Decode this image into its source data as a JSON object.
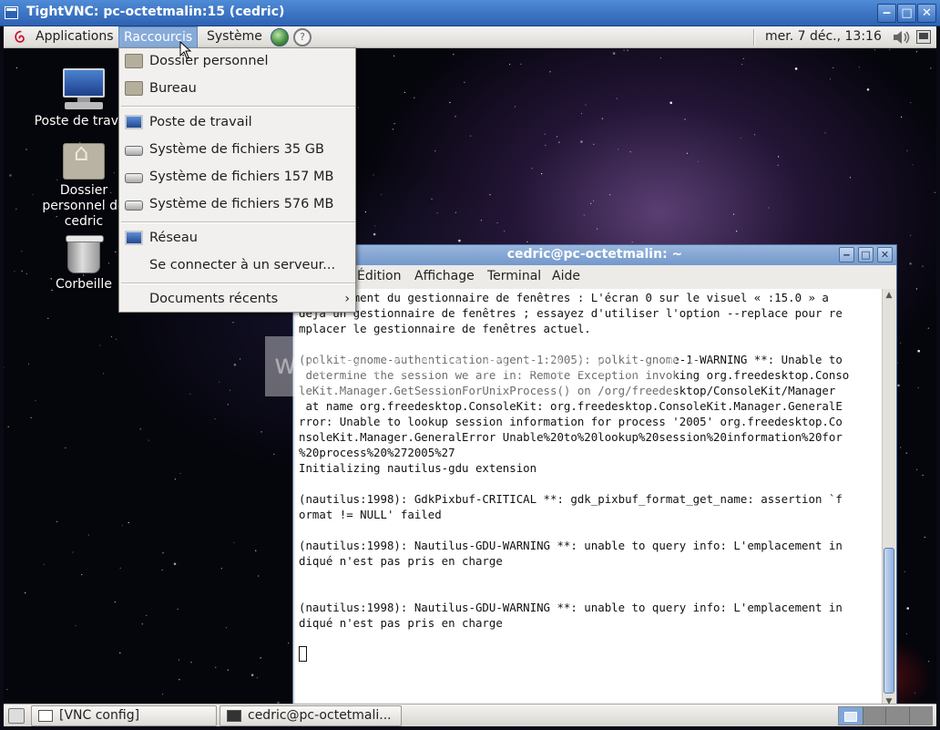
{
  "vnc_window": {
    "title": "TightVNC: pc-octetmalin:15 (cedric)",
    "minimize_symbol": "‒",
    "maximize_symbol": "□",
    "close_symbol": "✕"
  },
  "top_panel": {
    "menus": [
      "Applications",
      "Raccourcis",
      "Système"
    ],
    "clock": "mer.  7 déc., 13:16",
    "launcher_icons": [
      "network-browser-icon",
      "help-icon"
    ],
    "accent_color": "#86abd9"
  },
  "desktop": {
    "icons": [
      {
        "label": "Poste de travail",
        "icon": "computer-icon"
      },
      {
        "label": "Dossier personnel de cedric",
        "icon": "home-folder-icon"
      },
      {
        "label": "Corbeille",
        "icon": "trash-icon"
      }
    ]
  },
  "shortcut_menu": {
    "items": [
      {
        "label": "Dossier personnel",
        "icon": "folder-home-icon"
      },
      {
        "label": "Bureau",
        "icon": "folder-desktop-icon"
      },
      {
        "label": "Poste de travail",
        "icon": "computer-icon"
      },
      {
        "label": "Système de fichiers 35 GB",
        "icon": "drive-icon"
      },
      {
        "label": "Système de fichiers 157 MB",
        "icon": "drive-icon"
      },
      {
        "label": "Système de fichiers 576 MB",
        "icon": "drive-icon"
      },
      {
        "label": "Réseau",
        "icon": "network-icon"
      },
      {
        "label": "Se connecter à un serveur...",
        "icon": ""
      },
      {
        "label": "Documents récents",
        "icon": "",
        "submenu": true
      }
    ]
  },
  "terminal": {
    "title": "cedric@pc-octetmalin: ~",
    "menus": [
      "Édition",
      "Affichage",
      "Terminal",
      "Aide"
    ],
    "lines": [
      "       ement du gestionnaire de fenêtres : L'écran 0 sur le visuel « :15.0 » a",
      "déjà un gestionnaire de fenêtres ; essayez d'utiliser l'option --replace pour re",
      "mplacer le gestionnaire de fenêtres actuel.",
      "",
      "(polkit-gnome-authentication-agent-1:2005): polkit-gnome-1-WARNING **: Unable to",
      " determine the session we are in: Remote Exception invoking org.freedesktop.Conso",
      "leKit.Manager.GetSessionForUnixProcess() on /org/freedesktop/ConsoleKit/Manager",
      " at name org.freedesktop.ConsoleKit: org.freedesktop.ConsoleKit.Manager.GeneralE",
      "rror: Unable to lookup session information for process '2005' org.freedesktop.Co",
      "nsoleKit.Manager.GeneralError Unable%20to%20lookup%20session%20information%20for",
      "%20process%20%272005%27",
      "Initializing nautilus-gdu extension",
      "",
      "(nautilus:1998): GdkPixbuf-CRITICAL **: gdk_pixbuf_format_get_name: assertion `f",
      "ormat != NULL' failed",
      "",
      "(nautilus:1998): Nautilus-GDU-WARNING **: unable to query info: L'emplacement in",
      "diqué n'est pas pris en charge",
      "",
      "",
      "(nautilus:1998): Nautilus-GDU-WARNING **: unable to query info: L'emplacement in",
      "diqué n'est pas pris en charge"
    ]
  },
  "bottom_panel": {
    "tasks": [
      {
        "label": "[VNC config]"
      },
      {
        "label": "cedric@pc-octetmali..."
      }
    ],
    "workspace_count": 4,
    "active_workspace": 1
  }
}
